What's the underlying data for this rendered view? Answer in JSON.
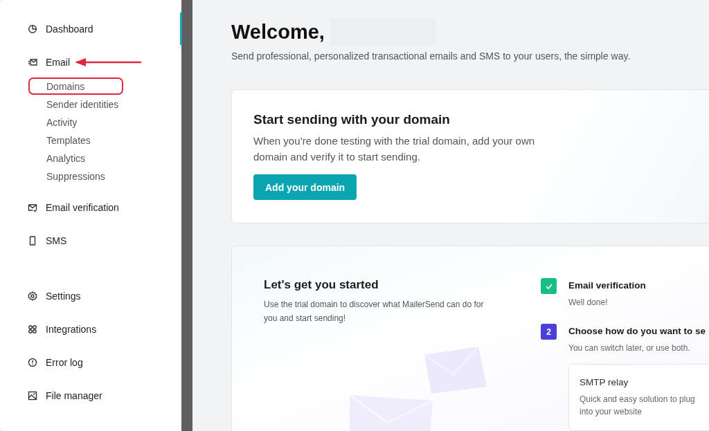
{
  "sidebar": {
    "sections": [
      {
        "items": [
          {
            "label": "Dashboard"
          },
          {
            "label": "Email",
            "annotated": true,
            "children": [
              {
                "label": "Domains",
                "annotated": true
              },
              {
                "label": "Sender identities",
                "annotated": false
              },
              {
                "label": "Activity",
                "annotated": false
              },
              {
                "label": "Templates",
                "annotated": false
              },
              {
                "label": "Analytics",
                "annotated": false
              },
              {
                "label": "Suppressions",
                "annotated": false
              }
            ]
          },
          {
            "label": "Email verification"
          },
          {
            "label": "SMS"
          }
        ]
      },
      {
        "items": [
          {
            "label": "Settings"
          },
          {
            "label": "Integrations"
          },
          {
            "label": "Error log"
          },
          {
            "label": "File manager"
          }
        ]
      }
    ]
  },
  "header": {
    "title": "Welcome,",
    "subtitle": "Send professional, personalized transactional emails and SMS to your users, the simple way."
  },
  "domain_card": {
    "title": "Start sending with your domain",
    "text": "When you’re done testing with the trial domain, add your own domain and verify it to start sending.",
    "button": "Add your domain"
  },
  "start_card": {
    "title": "Let's get you started",
    "text": "Use the trial domain to discover what MailerSend can do for you and start sending!",
    "steps": [
      {
        "kind": "done",
        "title": "Email verification",
        "text": "Well done!"
      },
      {
        "kind": "number",
        "number": "2",
        "title": "Choose how do you want to se",
        "text": "You can switch later, or use both.",
        "option": {
          "title": "SMTP relay",
          "text": "Quick and easy solution to plug into your website"
        }
      }
    ]
  }
}
